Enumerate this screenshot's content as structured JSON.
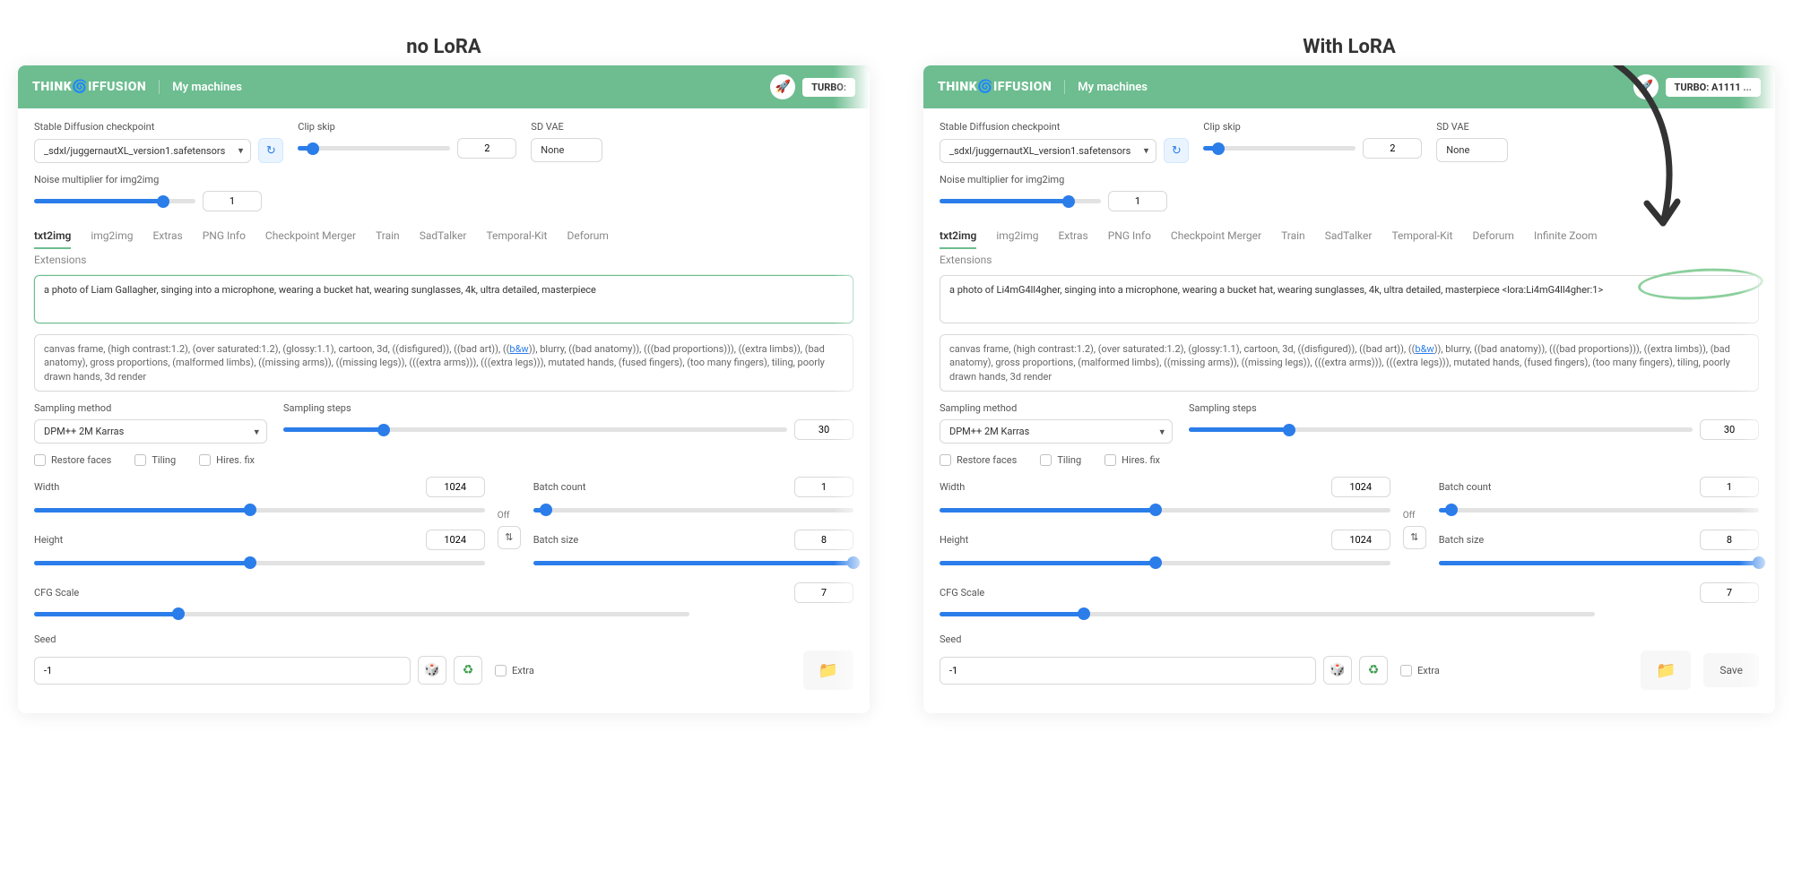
{
  "titles": {
    "left": "no LoRA",
    "right": "With LoRA"
  },
  "header": {
    "logo1": "THINK",
    "logo2": "IFFUSION",
    "link": "My machines",
    "turbo_left": "TURBO:",
    "turbo_right": "TURBO: A1111 ..."
  },
  "checkpoint": {
    "label": "Stable Diffusion checkpoint",
    "value": "_sdxl/juggernautXL_version1.safetensors"
  },
  "clipskip": {
    "label": "Clip skip",
    "value": "2"
  },
  "sdvae": {
    "label": "SD VAE",
    "value": "None"
  },
  "noise": {
    "label": "Noise multiplier for img2img",
    "value": "1"
  },
  "tabs": [
    "txt2img",
    "img2img",
    "Extras",
    "PNG Info",
    "Checkpoint Merger",
    "Train",
    "SadTalker",
    "Temporal-Kit",
    "Deforum",
    "Infinite Zoom"
  ],
  "extensions_label": "Extensions",
  "prompts": {
    "left": "a photo of Liam Gallagher, singing into a microphone, wearing a bucket hat, wearing sunglasses, 4k, ultra detailed, masterpiece",
    "right_pre": "a photo of Li4mG4ll4gher, singing into a microphone, wearing a bucket hat, wearing sunglasses, 4k, ultra detailed, masterpiece ",
    "right_lora": "<lora:Li4mG4ll4gher:1>"
  },
  "negprompt": {
    "p1": "canvas frame, (high contrast:1.2), (over saturated:1.2), (glossy:1.1), cartoon, 3d, ((disfigured)), ((bad art)), ((",
    "link": "b&w",
    "p2": ")), blurry, ((bad anatomy)), (((bad proportions))), ((extra limbs)), (bad anatomy), gross proportions, (malformed limbs), ((missing arms)), ((missing legs)), (((extra arms))), (((extra legs))), mutated hands, (fused fingers), (too many fingers), tiling, poorly drawn hands, 3d render"
  },
  "sampling": {
    "method_label": "Sampling method",
    "method_value": "DPM++ 2M Karras",
    "steps_label": "Sampling steps",
    "steps_value": "30"
  },
  "checks": {
    "restore": "Restore faces",
    "tiling": "Tiling",
    "hires": "Hires. fix"
  },
  "dims": {
    "width_label": "Width",
    "width_value": "1024",
    "height_label": "Height",
    "height_value": "1024",
    "off": "Off",
    "batch_count_label": "Batch count",
    "batch_count_value": "1",
    "batch_size_label": "Batch size",
    "batch_size_value": "8",
    "cfg_label": "CFG Scale",
    "cfg_value": "7"
  },
  "seed": {
    "label": "Seed",
    "value": "-1",
    "extra": "Extra"
  },
  "save_label": "Save"
}
